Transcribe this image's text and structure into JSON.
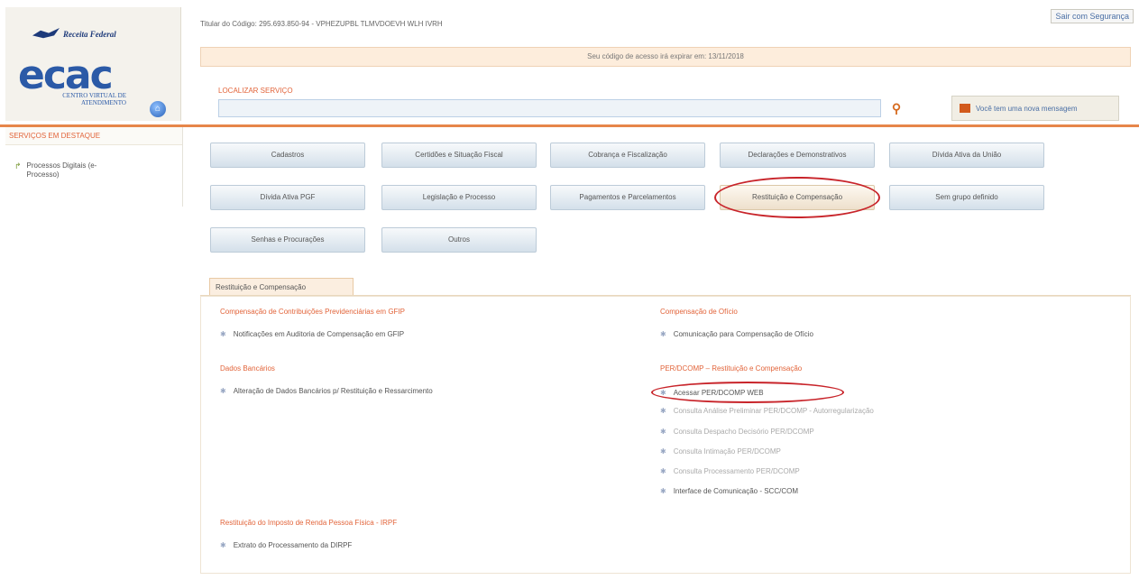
{
  "header": {
    "brand": "Receita Federal",
    "ecac_word": "cac",
    "ecac_e": "e",
    "ecac_subtitle": "CENTRO VIRTUAL DE ATENDIMENTO",
    "titular": "Titular do Código: 295.693.850-94 - VPHEZUPBL TLMVDOEVH WLH IVRH",
    "safe_exit": "Sair com Segurança",
    "expire_notice": "Seu código de acesso irá expirar em: 13/11/2018",
    "search_label": "LOCALIZAR SERVIÇO",
    "search_placeholder": "",
    "message_button": "Você tem uma nova mensagem"
  },
  "sidebar": {
    "title": "SERVIÇOS EM DESTAQUE",
    "item": "Processos Digitais (e-Processo)"
  },
  "categories": [
    "Cadastros",
    "Certidões e Situação Fiscal",
    "Cobrança e Fiscalização",
    "Declarações e Demonstrativos",
    "Dívida Ativa da União",
    "Dívida Ativa PGF",
    "Legislação e Processo",
    "Pagamentos e Parcelamentos",
    "Restituição e Compensação",
    "Sem grupo definido",
    "Senhas e Procurações",
    "Outros"
  ],
  "section": {
    "tab": "Restituição e Compensação",
    "groups": {
      "gfip_title": "Compensação de Contribuições Previdenciárias em GFIP",
      "gfip_link": "Notificações em Auditoria de Compensação em GFIP",
      "bank_title": "Dados Bancários",
      "bank_link": "Alteração de Dados Bancários p/ Restituição e Ressarcimento",
      "irpf_title": "Restituição do Imposto de Renda Pessoa Física - IRPF",
      "irpf_link": "Extrato do Processamento da DIRPF",
      "oficio_title": "Compensação de Ofício",
      "oficio_link": "Comunicação para Compensação de Ofício",
      "perdcomp_title": "PER/DCOMP – Restituição e Compensação",
      "perdcomp_links": [
        "Acessar PER/DCOMP WEB",
        "Consulta Análise Preliminar PER/DCOMP - Autorregularização",
        "Consulta Despacho Decisório PER/DCOMP",
        "Consulta Intimação PER/DCOMP",
        "Consulta Processamento PER/DCOMP",
        "Interface de Comunicação - SCC/COM"
      ]
    }
  }
}
